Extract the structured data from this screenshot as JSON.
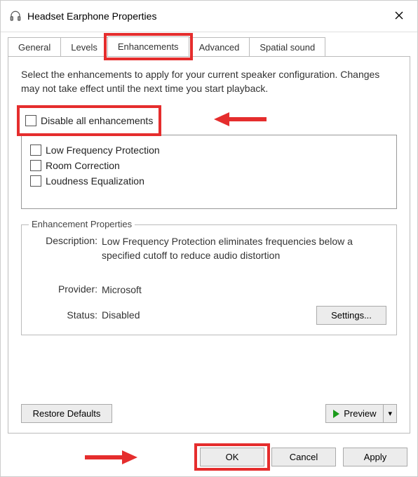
{
  "window": {
    "title": "Headset Earphone Properties"
  },
  "tabs": {
    "general": "General",
    "levels": "Levels",
    "enhancements": "Enhancements",
    "advanced": "Advanced",
    "spatial": "Spatial sound",
    "active": "enhancements"
  },
  "content": {
    "intro": "Select the enhancements to apply for your current speaker configuration. Changes may not take effect until the next time you start playback.",
    "disable_all_label": "Disable all enhancements",
    "enhancements": [
      {
        "label": "Low Frequency Protection",
        "checked": false
      },
      {
        "label": "Room Correction",
        "checked": false
      },
      {
        "label": "Loudness Equalization",
        "checked": false
      }
    ],
    "properties": {
      "legend": "Enhancement Properties",
      "description_label": "Description:",
      "description_value": "Low Frequency Protection eliminates frequencies below a specified cutoff to reduce audio distortion",
      "provider_label": "Provider:",
      "provider_value": "Microsoft",
      "status_label": "Status:",
      "status_value": "Disabled",
      "settings_button": "Settings..."
    },
    "restore_button": "Restore Defaults",
    "preview_button": "Preview"
  },
  "buttons": {
    "ok": "OK",
    "cancel": "Cancel",
    "apply": "Apply"
  }
}
